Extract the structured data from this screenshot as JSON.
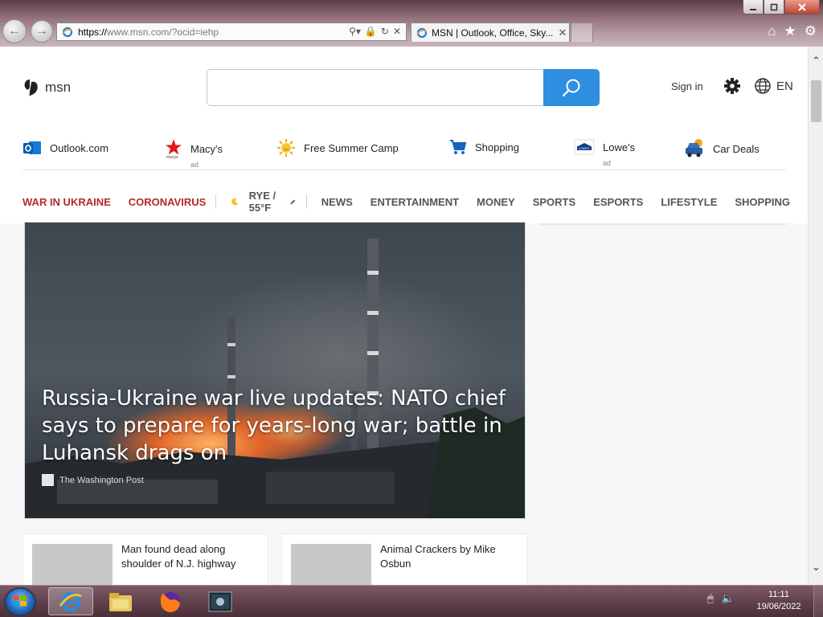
{
  "browser": {
    "address_proto": "https://",
    "address_rest": "www.msn.com/?ocid=iehp",
    "tab_title": "MSN | Outlook, Office, Sky...",
    "tab_close": "✕"
  },
  "header": {
    "logo_text": "msn",
    "search_placeholder": "",
    "sign_in": "Sign in",
    "language": "EN"
  },
  "quick_links": [
    {
      "label": "Outlook.com",
      "ad": "",
      "icon": "outlook-icon"
    },
    {
      "label": "Macy's",
      "ad": "ad",
      "icon": "macys-star-icon"
    },
    {
      "label": "Free Summer Camp",
      "ad": "",
      "icon": "sun-icon"
    },
    {
      "label": "Shopping",
      "ad": "",
      "icon": "cart-icon"
    },
    {
      "label": "Lowe's",
      "ad": "ad",
      "icon": "lowes-icon"
    },
    {
      "label": "Car Deals",
      "ad": "",
      "icon": "car-icon"
    }
  ],
  "nav": {
    "highlight": [
      "WAR IN UKRAINE",
      "CORONAVIRUS"
    ],
    "weather": "RYE / 55°F",
    "categories": [
      "NEWS",
      "ENTERTAINMENT",
      "MONEY",
      "SPORTS",
      "ESPORTS",
      "LIFESTYLE",
      "SHOPPING"
    ]
  },
  "hero": {
    "title": "Russia-Ukraine war live updates: NATO chief says to prepare for years-long war; battle in Luhansk drags on",
    "source": "The Washington Post"
  },
  "cards": [
    {
      "title": "Man found dead along shoulder of N.J. highway"
    },
    {
      "title": "Animal Crackers by Mike Osbun"
    }
  ],
  "taskbar": {
    "time": "11:11",
    "date": "19/06/2022"
  },
  "colors": {
    "accent_blue": "#2f8ee0",
    "highlight_red": "#b22a2a"
  }
}
